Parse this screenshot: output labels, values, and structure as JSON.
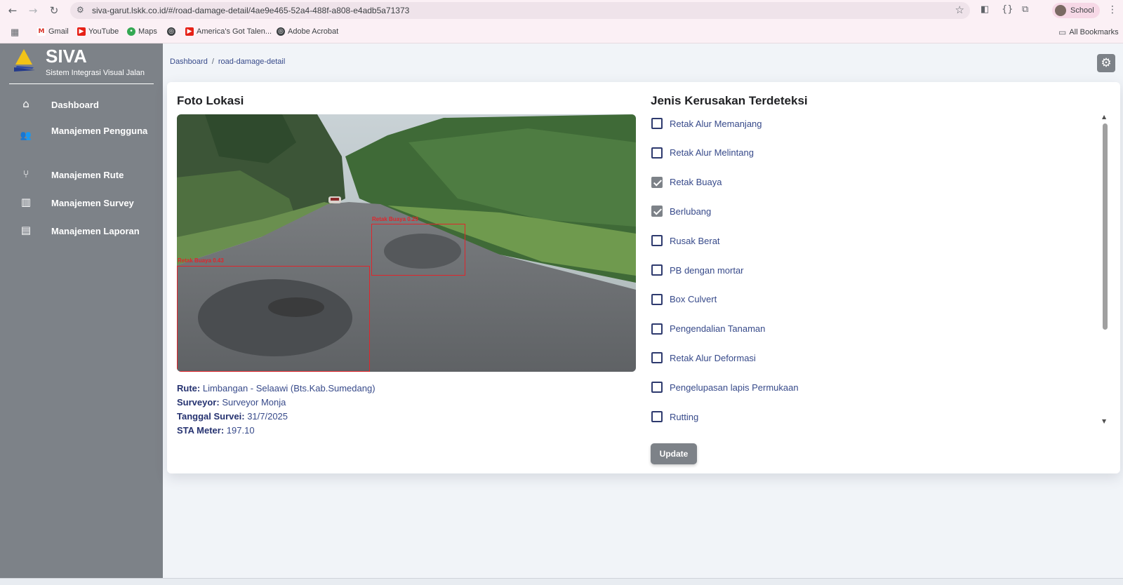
{
  "browser": {
    "url": "siva-garut.lskk.co.id/#/road-damage-detail/4ae9e465-52a4-488f-a808-e4adb5a71373",
    "profile_label": "School",
    "bookmarks": [
      "Gmail",
      "YouTube",
      "Maps",
      "America's Got Talen...",
      "Adobe Acrobat"
    ],
    "all_bookmarks": "All Bookmarks"
  },
  "sidebar": {
    "brand": "SIVA",
    "subtitle": "Sistem Integrasi Visual Jalan",
    "items": [
      {
        "label": "Dashboard",
        "icon": "home-icon"
      },
      {
        "label": "Manajemen Pengguna",
        "icon": "users-icon"
      },
      {
        "label": "Manajemen Rute",
        "icon": "route-fork-icon"
      },
      {
        "label": "Manajemen Survey",
        "icon": "bar-chart-icon"
      },
      {
        "label": "Manajemen Laporan",
        "icon": "report-document-icon"
      }
    ]
  },
  "breadcrumb": {
    "root": "Dashboard",
    "separator": "/",
    "current": "road-damage-detail"
  },
  "photo_section": {
    "title": "Foto Lokasi",
    "detections": [
      "Retak Buaya 0.29",
      "Retak Buaya 0.43"
    ]
  },
  "info": {
    "route_label": "Rute:",
    "route_value": "Limbangan - Selaawi (Bts.Kab.Sumedang)",
    "surveyor_label": "Surveyor:",
    "surveyor_value": "Surveyor Monja",
    "date_label": "Tanggal Survei:",
    "date_value": "31/7/2025",
    "sta_label": "STA Meter:",
    "sta_value": "197.10"
  },
  "damage_section": {
    "title": "Jenis Kerusakan Terdeteksi",
    "items": [
      {
        "label": "Retak Alur Memanjang",
        "checked": false
      },
      {
        "label": "Retak Alur Melintang",
        "checked": false
      },
      {
        "label": "Retak Buaya",
        "checked": true
      },
      {
        "label": "Berlubang",
        "checked": true
      },
      {
        "label": "Rusak Berat",
        "checked": false
      },
      {
        "label": "PB dengan mortar",
        "checked": false
      },
      {
        "label": "Box Culvert",
        "checked": false
      },
      {
        "label": "Pengendalian Tanaman",
        "checked": false
      },
      {
        "label": "Retak Alur Deformasi",
        "checked": false
      },
      {
        "label": "Pengelupasan lapis Permukaan",
        "checked": false
      },
      {
        "label": "Rutting",
        "checked": false
      }
    ],
    "update_label": "Update"
  },
  "colors": {
    "sidebar": "#7d8288",
    "accent_text": "#374a8a",
    "detection": "#e0252b",
    "background": "#f1f4f8"
  }
}
